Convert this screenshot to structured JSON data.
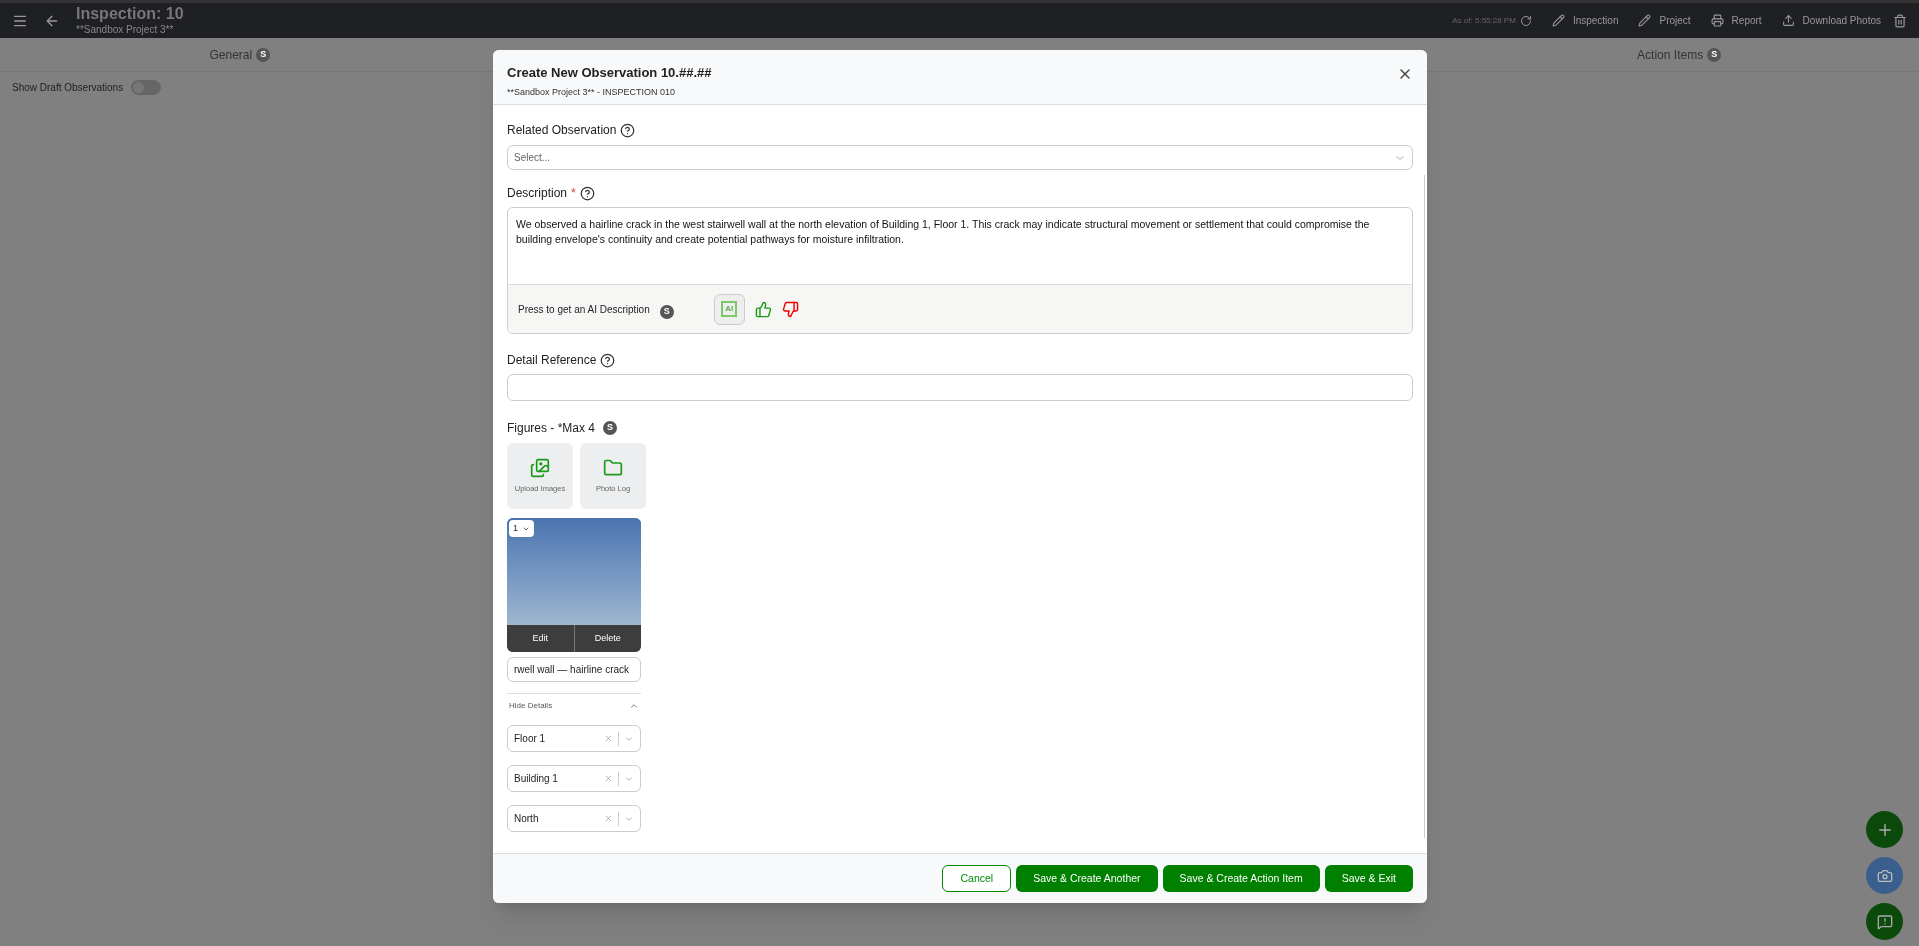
{
  "app_bar": {
    "title": "Inspection: 10",
    "subtitle": "**Sandbox Project 3**",
    "as_of": "As of: 5:55:28 PM",
    "actions": [
      {
        "kind": "edit",
        "label": "Inspection"
      },
      {
        "kind": "edit",
        "label": "Project"
      },
      {
        "kind": "report",
        "label": "Report"
      },
      {
        "kind": "download",
        "label": "Download Photos"
      }
    ]
  },
  "tabs": [
    {
      "label": "General",
      "badge": "S",
      "selected": false
    },
    {
      "label": "Action Items",
      "badge": "S",
      "selected": false
    }
  ],
  "draft_toggle": {
    "label": "Show Draft Observations",
    "on": false
  },
  "modal": {
    "title": "Create New Observation 10.##.##",
    "subtitle": "**Sandbox Project 3** - INSPECTION 010",
    "related": {
      "label": "Related Observation",
      "placeholder": "Select..."
    },
    "description": {
      "label": "Description",
      "required_mark": "*",
      "value": "We observed a hairline crack in the west stairwell wall at the north elevation of Building 1, Floor 1. This crack may indicate structural movement or settlement that could compromise the building envelope's continuity and create potential pathways for moisture infiltration.",
      "ai_prompt": "Press to get an AI Description",
      "ai_badge": "S",
      "ai_icon_text": "AI"
    },
    "detail_reference": {
      "label": "Detail Reference"
    },
    "figures": {
      "label": "Figures - *Max 4",
      "badge": "S",
      "sources": [
        {
          "kind": "upload",
          "label": "Upload Images"
        },
        {
          "kind": "log",
          "label": "Photo Log"
        }
      ],
      "items": [
        {
          "order": "1",
          "edit": "Edit",
          "delete": "Delete",
          "caption": "rwell wall — hairline crack",
          "details_toggle": "Hide Details",
          "expanded": true,
          "tags": [
            "Floor 1",
            "Building 1",
            "North"
          ]
        }
      ]
    },
    "buttons": [
      {
        "kind": "outline",
        "label": "Cancel"
      },
      {
        "kind": "solid",
        "label": "Save & Create Another"
      },
      {
        "kind": "solid",
        "label": "Save & Create Action Item"
      },
      {
        "kind": "solid",
        "label": "Save & Exit"
      }
    ]
  }
}
